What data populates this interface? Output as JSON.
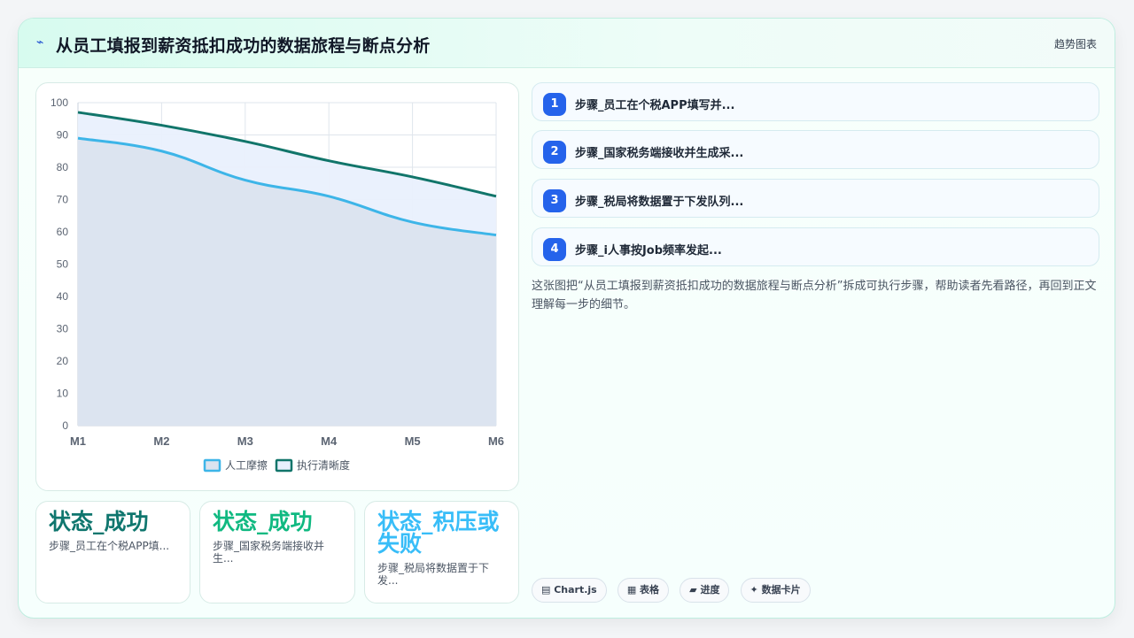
{
  "header": {
    "icon": "pulse-icon",
    "title": "从员工填报到薪资抵扣成功的数据旅程与断点分析",
    "tag": "趋势图表"
  },
  "chart_data": {
    "type": "area",
    "categories": [
      "M1",
      "M2",
      "M3",
      "M4",
      "M5",
      "M6"
    ],
    "series": [
      {
        "name": "人工摩擦",
        "values": [
          89,
          85,
          76,
          71,
          63,
          59
        ],
        "color": "#3db5e8",
        "fill": "#dbe3ef"
      },
      {
        "name": "执行清晰度",
        "values": [
          97,
          93,
          88,
          82,
          77,
          71
        ],
        "color": "#11756a",
        "fill": "#e9f0fd"
      }
    ],
    "ylim": [
      0,
      100
    ],
    "yticks": [
      "0",
      "10",
      "20",
      "30",
      "40",
      "50",
      "60",
      "70",
      "80",
      "90",
      "100"
    ],
    "grid": true,
    "legend": "bottom"
  },
  "stats": [
    {
      "value": "状态_成功",
      "label": "步骤_员工在个税APP填...",
      "color": "#0f766e"
    },
    {
      "value": "状态_成功",
      "label": "步骤_国家税务端接收并生...",
      "color": "#10b981"
    },
    {
      "value": "状态_积压或失败",
      "label": "步骤_税局将数据置于下发...",
      "color": "#38bdf8"
    }
  ],
  "steps": [
    {
      "num": "1",
      "label": "步骤_员工在个税APP填写并..."
    },
    {
      "num": "2",
      "label": "步骤_国家税务端接收并生成采..."
    },
    {
      "num": "3",
      "label": "步骤_税局将数据置于下发队列..."
    },
    {
      "num": "4",
      "label": "步骤_i人事按Job频率发起..."
    }
  ],
  "description": "这张图把“从员工填报到薪资抵扣成功的数据旅程与断点分析”拆成可执行步骤，帮助读者先看路径，再回到正文理解每一步的细节。",
  "chips": [
    {
      "icon": "chart-icon",
      "text": "▤ Chart.js"
    },
    {
      "icon": "table-icon",
      "text": "▦ 表格"
    },
    {
      "icon": "progress-icon",
      "text": "▰ 进度"
    },
    {
      "icon": "sparkle-icon",
      "text": "✦ 数据卡片"
    }
  ]
}
